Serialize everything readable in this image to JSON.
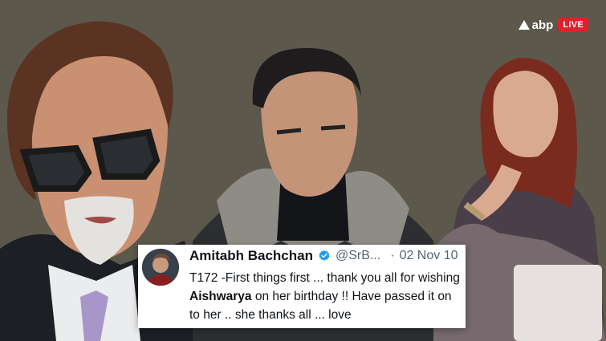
{
  "brand": {
    "logo_text": "abp",
    "live_label": "LIVE",
    "accent": "#e0202a"
  },
  "tweet": {
    "author_name": "Amitabh Bachchan",
    "handle": "@SrB...",
    "separator": "·",
    "date": "02 Nov 10",
    "text_part1": "T172 -First things first ... thank you all for wishing ",
    "text_bold": "Aishwarya",
    "text_part2": " on her birthday !! Have passed it on to her .. she thanks all ... love",
    "verified_color": "#1d9bf0"
  },
  "icons": {
    "logo_mark": "abp-logo-icon",
    "verified": "verified-badge-icon",
    "avatar": "avatar"
  }
}
